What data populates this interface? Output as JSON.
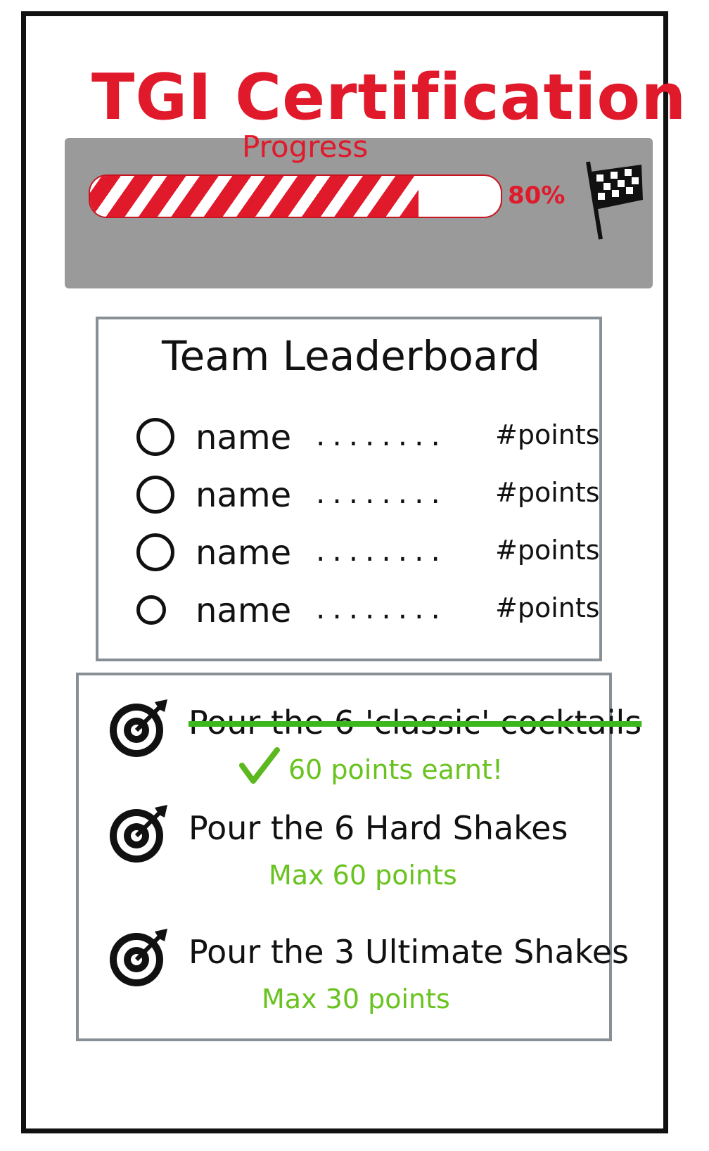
{
  "header": {
    "title": "TGI Certification",
    "progress_label": "Progress",
    "progress_value": "80%",
    "progress_fraction": 0.8
  },
  "leaderboard": {
    "title": "Team Leaderboard",
    "rows": [
      {
        "name": "name",
        "points": "#points"
      },
      {
        "name": "name",
        "points": "#points"
      },
      {
        "name": "name",
        "points": "#points"
      },
      {
        "name": "name",
        "points": "#points"
      }
    ]
  },
  "goals": [
    {
      "title": "Pour the 6 'classic' cocktails",
      "note": "60 points earnt!",
      "completed": true
    },
    {
      "title": "Pour the 6 Hard Shakes",
      "note": "Max 60 points",
      "completed": false
    },
    {
      "title": "Pour the 3 Ultimate Shakes",
      "note": "Max 30 points",
      "completed": false
    }
  ],
  "colors": {
    "accent_red": "#e01a2b",
    "success_green": "#69c31f",
    "panel_gray": "#9a9a9a"
  },
  "icons": [
    "finish-flag-icon",
    "avatar-icon",
    "target-icon",
    "check-icon"
  ]
}
